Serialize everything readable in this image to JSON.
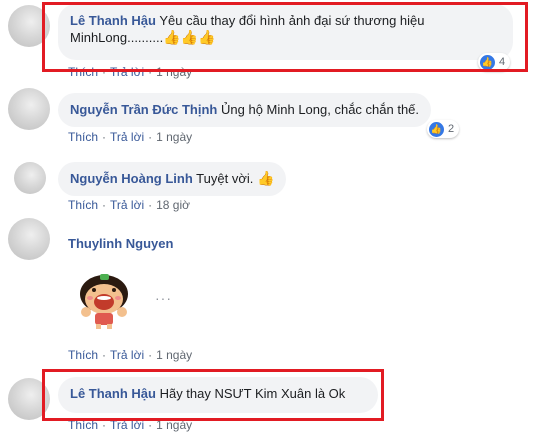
{
  "comments": [
    {
      "name": "Lê Thanh Hậu",
      "text": "Yêu cầu thay đổi hình ảnh đại sứ thương hiệu MinhLong..........",
      "emoji": "👍👍👍",
      "like": "Thích",
      "reply": "Trả lời",
      "time": "1 ngày",
      "reactions": "4"
    },
    {
      "name": "Nguyễn Trần Đức Thịnh",
      "text": "Ủng hộ Minh Long, chắc chắn thế.",
      "like": "Thích",
      "reply": "Trả lời",
      "time": "1 ngày",
      "reactions": "2"
    },
    {
      "name": "Nguyễn Hoàng Linh",
      "text": "Tuyệt vời.",
      "emoji": "👍",
      "like": "Thích",
      "reply": "Trả lời",
      "time": "18 giờ"
    },
    {
      "name": "Thuylinh Nguyen",
      "like": "Thích",
      "reply": "Trả lời",
      "time": "1 ngày",
      "more_icon": "more-options-icon"
    },
    {
      "name": "Lê Thanh Hậu",
      "text": "Hãy thay NSƯT Kim Xuân là Ok",
      "like": "Thích",
      "reply": "Trả lời",
      "time": "1 ngày"
    }
  ],
  "colors": {
    "name": "#385898",
    "bubble": "#f2f3f5",
    "highlight": "#e21b23",
    "like": "#3578e5"
  }
}
